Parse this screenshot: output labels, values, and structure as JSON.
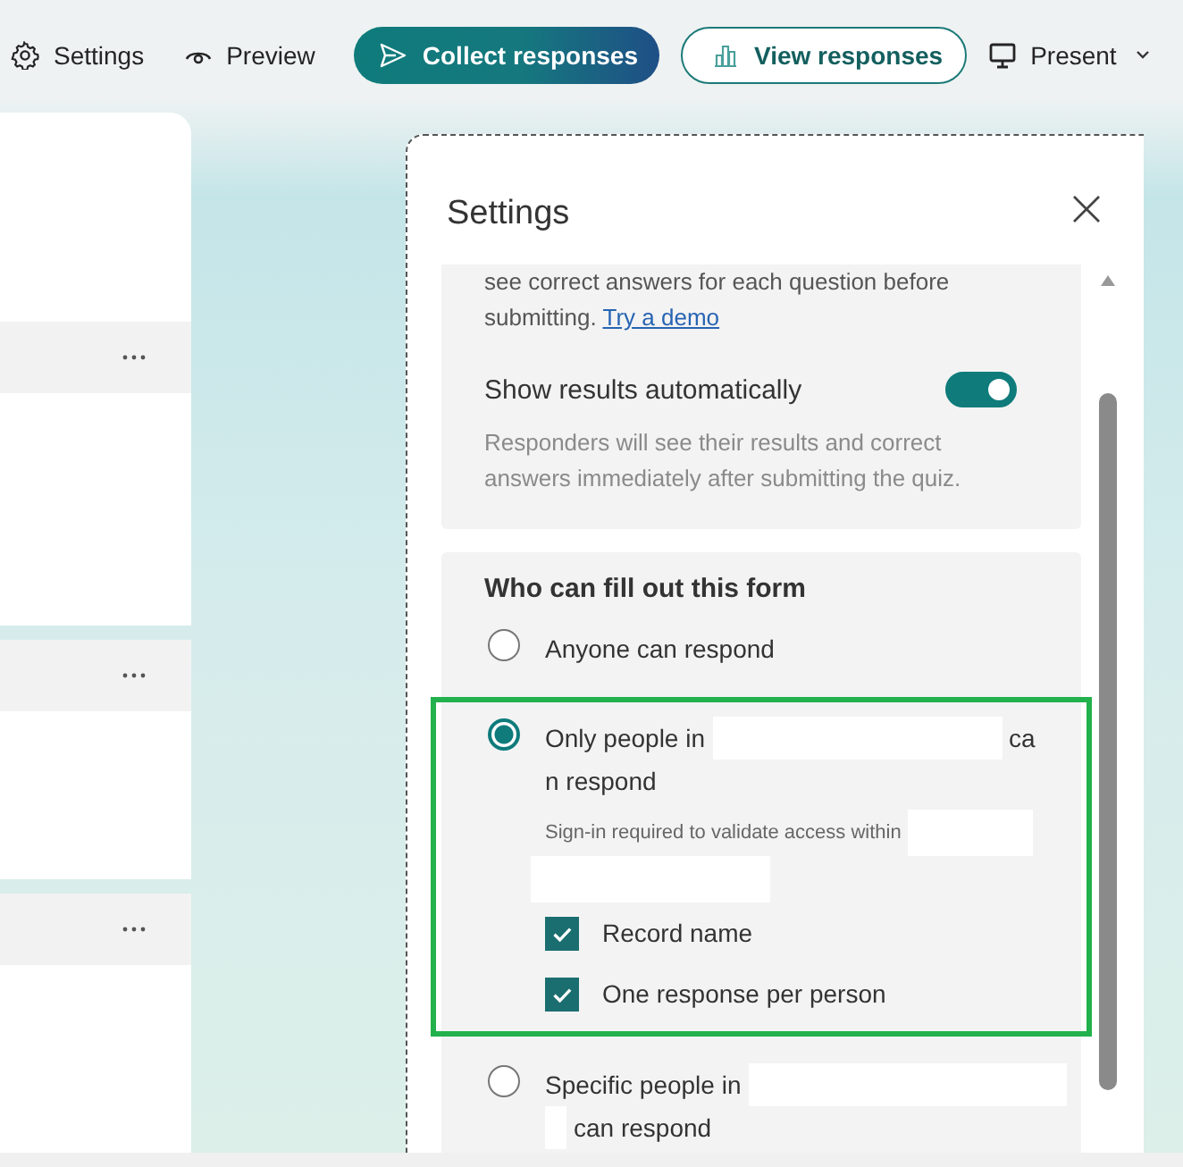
{
  "toolbar": {
    "items": [
      {
        "label": "Settings",
        "kind": "plain"
      },
      {
        "label": "Preview",
        "kind": "plain"
      },
      {
        "label": "Collect responses",
        "kind": "primary"
      },
      {
        "label": "View responses",
        "kind": "outline"
      },
      {
        "label": "Present",
        "kind": "plain"
      }
    ]
  },
  "settings_panel": {
    "title": "Settings",
    "practice_card": {
      "text": "see correct answers for each question before submitting.",
      "link": "Try a demo",
      "toggle": {
        "label": "Show results automatically",
        "on": true
      },
      "toggle_description": "Responders will see their results and correct answers immediately after submitting the quiz."
    },
    "access_card": {
      "heading": "Who can fill out this form",
      "options": [
        {
          "selected": false,
          "highlighted": false,
          "lines": [
            [
              {
                "kind": "text",
                "text": "Anyone can respond"
              }
            ]
          ]
        },
        {
          "selected": true,
          "highlighted": true,
          "lines": [
            [
              {
                "kind": "text",
                "text": "Only people in"
              },
              {
                "kind": "redacted"
              },
              {
                "kind": "text",
                "text": "ca"
              }
            ],
            [
              {
                "kind": "text",
                "text": "n respond"
              }
            ]
          ],
          "note_lines": [
            [
              {
                "kind": "text",
                "text": "Sign-in required to validate access within"
              },
              {
                "kind": "redacted"
              }
            ],
            [
              {
                "kind": "redacted"
              }
            ]
          ],
          "checkboxes": [
            {
              "label": "Record name",
              "checked": true
            },
            {
              "label": "One response per person",
              "checked": true
            }
          ]
        },
        {
          "selected": false,
          "highlighted": false,
          "lines": [
            [
              {
                "kind": "text",
                "text": "Specific people in"
              },
              {
                "kind": "redacted"
              }
            ],
            [
              {
                "kind": "redacted"
              },
              {
                "kind": "text",
                "text": "can respond"
              }
            ]
          ]
        }
      ]
    }
  }
}
